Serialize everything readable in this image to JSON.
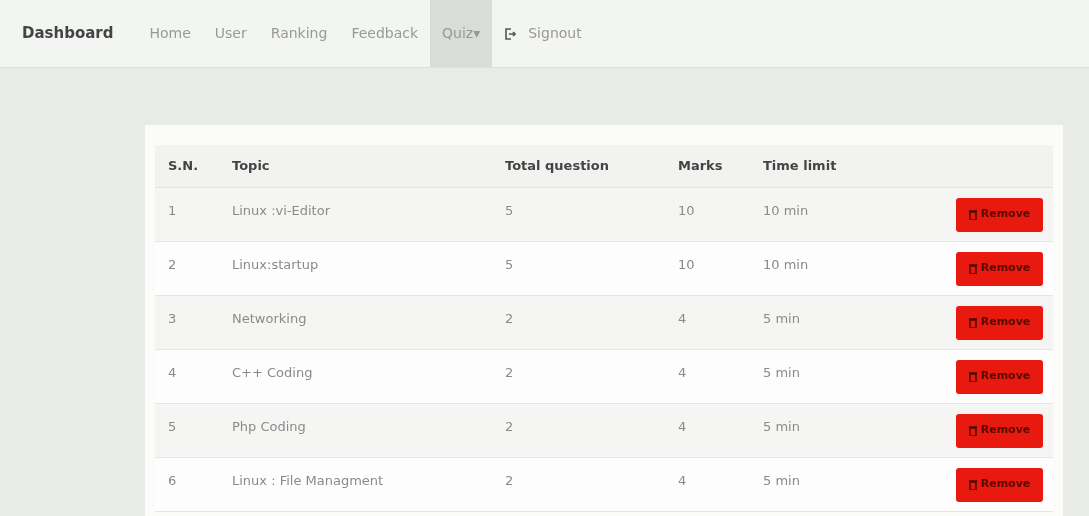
{
  "navbar": {
    "brand": "Dashboard",
    "items": [
      {
        "label": "Home",
        "selected": false
      },
      {
        "label": "User",
        "selected": false
      },
      {
        "label": "Ranking",
        "selected": false
      },
      {
        "label": "Feedback",
        "selected": false
      },
      {
        "label": "Quiz▾",
        "selected": true
      },
      {
        "label": "Signout",
        "selected": false,
        "kind": "signout"
      }
    ]
  },
  "table": {
    "columns": [
      "S.N.",
      "Topic",
      "Total question",
      "Marks",
      "Time limit"
    ],
    "rows": [
      {
        "cells": [
          "1",
          "Linux :vi-Editor",
          "5",
          "10",
          "10 min"
        ],
        "action": "Remove"
      },
      {
        "cells": [
          "2",
          "Linux:startup",
          "5",
          "10",
          "10 min"
        ],
        "action": "Remove"
      },
      {
        "cells": [
          "3",
          "Networking",
          "2",
          "4",
          "5 min"
        ],
        "action": "Remove"
      },
      {
        "cells": [
          "4",
          "C++ Coding",
          "2",
          "4",
          "5 min"
        ],
        "action": "Remove"
      },
      {
        "cells": [
          "5",
          "Php Coding",
          "2",
          "4",
          "5 min"
        ],
        "action": "Remove"
      },
      {
        "cells": [
          "6",
          "Linux : File Managment",
          "2",
          "4",
          "5 min"
        ],
        "action": "Remove"
      }
    ]
  }
}
